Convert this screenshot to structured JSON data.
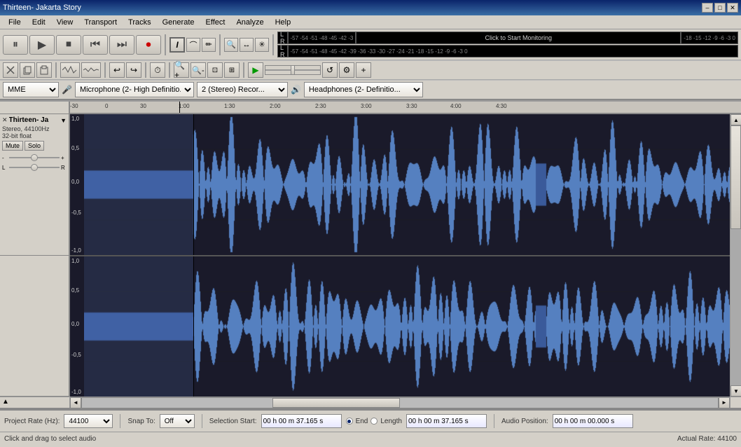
{
  "titlebar": {
    "title": "Thirteen- Jakarta Story",
    "minimize_label": "–",
    "maximize_label": "□",
    "close_label": "✕"
  },
  "menu": {
    "items": [
      "File",
      "Edit",
      "View",
      "Transport",
      "Tracks",
      "Generate",
      "Effect",
      "Analyze",
      "Help"
    ]
  },
  "transport": {
    "pause_label": "⏸",
    "play_label": "▶",
    "stop_label": "⏹",
    "skip_back_label": "⏮",
    "skip_fwd_label": "⏭",
    "record_label": "⏺"
  },
  "tools": {
    "select_icon": "I",
    "envelope_icon": "~",
    "draw_icon": "✏",
    "zoom_icon": "🔍",
    "timeshift_icon": "↔",
    "multi_icon": "✳"
  },
  "meter": {
    "left_label": "L",
    "right_label": "R",
    "click_to_start": "Click to Start Monitoring",
    "scale": "-57 -54 -51 -48 -45 -42 -3",
    "scale2": "-57 -54 -51 -48 -45 -42 -39 -36 -33 -30 -27 -24 -21 -18 -15 -12 -9 -6 -3 0"
  },
  "ruler": {
    "labels": [
      "-30",
      "0",
      "30",
      "1:00",
      "1:30",
      "2:00",
      "2:30",
      "3:00",
      "3:30",
      "4:00",
      "4:30"
    ]
  },
  "track1": {
    "name": "Thirteen- Ja",
    "info1": "Stereo, 44100Hz",
    "info2": "32-bit float",
    "mute_label": "Mute",
    "solo_label": "Solo"
  },
  "devices": {
    "api_label": "MME",
    "mic_label": "Microphone (2- High Definitio...",
    "channels_label": "2 (Stereo) Recor...",
    "speakers_label": "Headphones (2- Definitio..."
  },
  "bottom": {
    "project_rate_label": "Project Rate (Hz):",
    "project_rate_value": "44100",
    "snap_to_label": "Snap To:",
    "snap_to_value": "Off",
    "selection_start_label": "Selection Start:",
    "selection_start_value": "00 h 00 m 37.165 s",
    "end_label": "End",
    "length_label": "Length",
    "end_value": "00 h 00 m 37.165 s",
    "audio_position_label": "Audio Position:",
    "audio_position_value": "00 h 00 m 00.000 s",
    "status_left": "Click and drag to select audio",
    "actual_rate": "Actual Rate: 44100"
  }
}
